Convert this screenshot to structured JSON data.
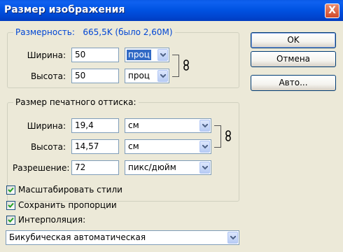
{
  "window": {
    "title": "Размер изображения",
    "close_label": "X"
  },
  "pixel_dimensions": {
    "title": "Размерность:",
    "size_text": "665,5K (было 2,60M)",
    "width_label": "Ширина:",
    "width_value": "50",
    "width_unit": "проц",
    "height_label": "Высота:",
    "height_value": "50",
    "height_unit": "проц"
  },
  "document_size": {
    "title": "Размер печатного оттиска:",
    "width_label": "Ширина:",
    "width_value": "19,4",
    "width_unit": "см",
    "height_label": "Высота:",
    "height_value": "14,57",
    "height_unit": "см",
    "resolution_label": "Разрешение:",
    "resolution_value": "72",
    "resolution_unit": "пикс/дюйм"
  },
  "buttons": {
    "ok": "OK",
    "cancel": "Отмена",
    "auto": "Авто..."
  },
  "options": {
    "scale_styles": {
      "label": "Масштабировать стили",
      "checked": true
    },
    "constrain_proportions": {
      "label": "Сохранить пропорции",
      "checked": true
    },
    "resample": {
      "label": "Интерполяция:",
      "checked": true
    },
    "resample_method": "Бикубическая автоматическая"
  },
  "colors": {
    "title_bar": "#0054e3",
    "group_title": "#0046d5",
    "face": "#ece9d8",
    "field_border": "#7f9db9"
  },
  "icons": {
    "close": "close-icon",
    "dropdown": "chevron-down-icon",
    "link": "chain-link-icon",
    "check": "checkmark-icon"
  }
}
